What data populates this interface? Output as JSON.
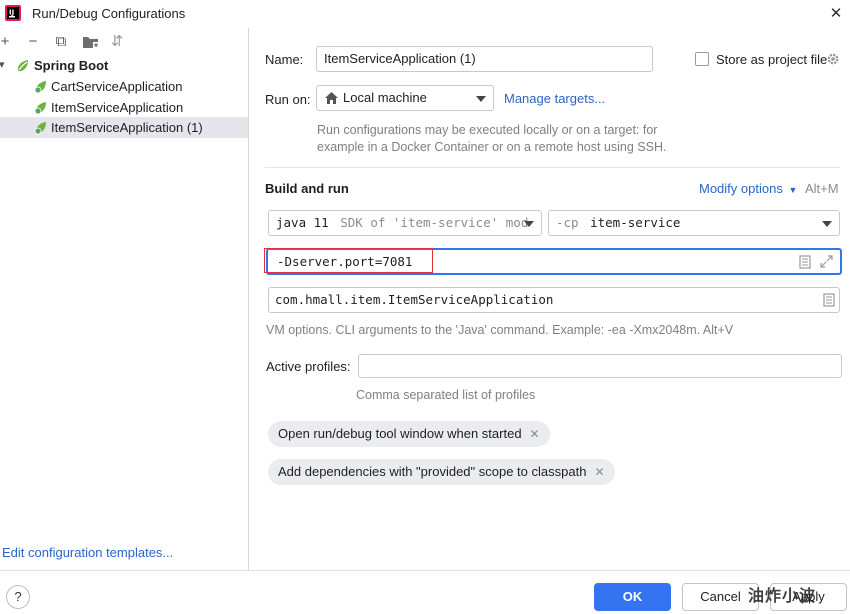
{
  "window": {
    "title": "Run/Debug Configurations",
    "close_glyph": "✕"
  },
  "toolbar": {
    "add": "+",
    "remove": "−",
    "copy": "⧉",
    "folder": "▇",
    "sort": "⇵"
  },
  "tree": {
    "group": {
      "label": "Spring Boot",
      "expand_glyph": "▾"
    },
    "items": [
      {
        "label": "CartServiceApplication"
      },
      {
        "label": "ItemServiceApplication"
      },
      {
        "label": "ItemServiceApplication (1)"
      }
    ]
  },
  "left_footer": {
    "link": "Edit configuration templates..."
  },
  "form": {
    "name_label": "Name:",
    "name_value": "ItemServiceApplication (1)",
    "store_label": "Store as project file",
    "run_on_label": "Run on:",
    "run_on_value": "Local machine",
    "manage_targets": "Manage targets...",
    "run_on_hint_1": "Run configurations may be executed locally or on a target: for",
    "run_on_hint_2": "example in a Docker Container or on a remote host using SSH.",
    "build_run_title": "Build and run",
    "modify_options": "Modify options",
    "modify_shortcut": "Alt+M",
    "sdk_java": "java 11",
    "sdk_hint": "SDK of 'item-service' mod",
    "cp_prefix": "-cp",
    "cp_value": "item-service",
    "vm_options": "-Dserver.port=7081",
    "main_class": "com.hmall.item.ItemServiceApplication",
    "vm_hint": "VM options. CLI arguments to the 'Java' command. Example: -ea -Xmx2048m. Alt+V",
    "profiles_label": "Active profiles:",
    "profiles_value": "",
    "profiles_hint": "Comma separated list of profiles",
    "chip_1": "Open run/debug tool window when started",
    "chip_2": "Add dependencies with \"provided\" scope to classpath",
    "chip_close": "✕"
  },
  "buttons": {
    "help": "?",
    "ok": "OK",
    "cancel": "Cancel",
    "apply": "Apply"
  },
  "watermark": "油炸小波",
  "colors": {
    "accent": "#3574f0",
    "link": "#2a65c8",
    "highlight_box": "#e0303a",
    "selection": "#e4e6eb",
    "spring_green": "#6db33f"
  }
}
